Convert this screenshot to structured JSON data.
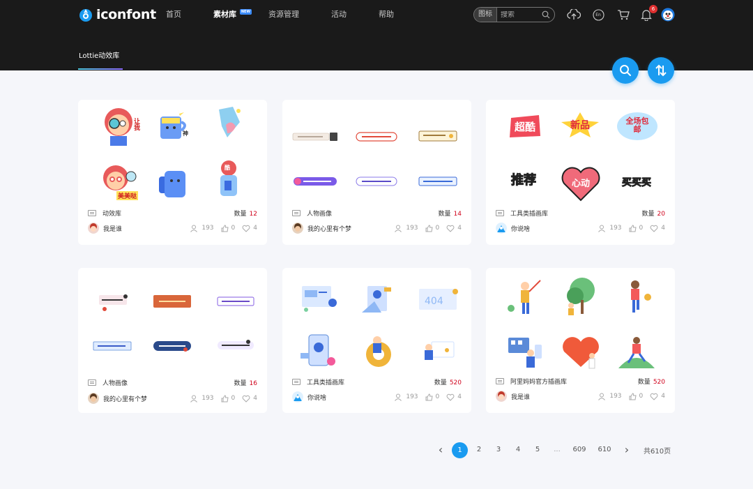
{
  "brand": {
    "name": "iconfont"
  },
  "nav": {
    "items": [
      {
        "label": "首页",
        "active": false
      },
      {
        "label": "素材库",
        "active": true,
        "badge": "NEW"
      },
      {
        "label": "资源管理",
        "active": false
      },
      {
        "label": "活动",
        "active": false
      },
      {
        "label": "帮助",
        "active": false
      }
    ]
  },
  "search": {
    "type": "图标",
    "placeholder": "搜索"
  },
  "header_icons": {
    "notifications": "6",
    "lang": "En"
  },
  "subnav": {
    "tab": "Lottie动效库"
  },
  "cards": [
    {
      "title": "动效库",
      "count_label": "数量",
      "count": "12",
      "author": "我是谁",
      "views": "193",
      "likes": "0",
      "favs": "4",
      "theme": "stickers"
    },
    {
      "title": "人物画像",
      "count_label": "数量",
      "count": "14",
      "author": "我的心里有个梦",
      "views": "193",
      "likes": "0",
      "favs": "4",
      "theme": "banners"
    },
    {
      "title": "工具类插画库",
      "count_label": "数量",
      "count": "20",
      "author": "你说啥",
      "views": "193",
      "likes": "0",
      "favs": "4",
      "theme": "words"
    },
    {
      "title": "人物画像",
      "count_label": "数量",
      "count": "16",
      "author": "我的心里有个梦",
      "views": "193",
      "likes": "0",
      "favs": "4",
      "theme": "banners2"
    },
    {
      "title": "工具类插画库",
      "count_label": "数量",
      "count": "520",
      "author": "你说啥",
      "views": "193",
      "likes": "0",
      "favs": "4",
      "theme": "tech"
    },
    {
      "title": "阿里妈妈官方插画库",
      "count_label": "数量",
      "count": "520",
      "author": "我是谁",
      "views": "193",
      "likes": "0",
      "favs": "4",
      "theme": "people"
    }
  ],
  "stickers_text": {
    "a": "让我",
    "b": "神",
    "c": "美美哒",
    "d": "酷"
  },
  "words_text": {
    "a": "超酷",
    "b": "新品",
    "c": "全场包邮",
    "d": "推荐",
    "e": "心动",
    "f": "买买买"
  },
  "pagination": {
    "prev": "‹",
    "pages": [
      "1",
      "2",
      "3",
      "4",
      "5",
      "...",
      "609",
      "610"
    ],
    "next": "›",
    "total": "共610页",
    "current": "1"
  },
  "colors": {
    "accent": "#1a9bf0",
    "count": "#d0021b",
    "header": "#1a1a1a"
  }
}
